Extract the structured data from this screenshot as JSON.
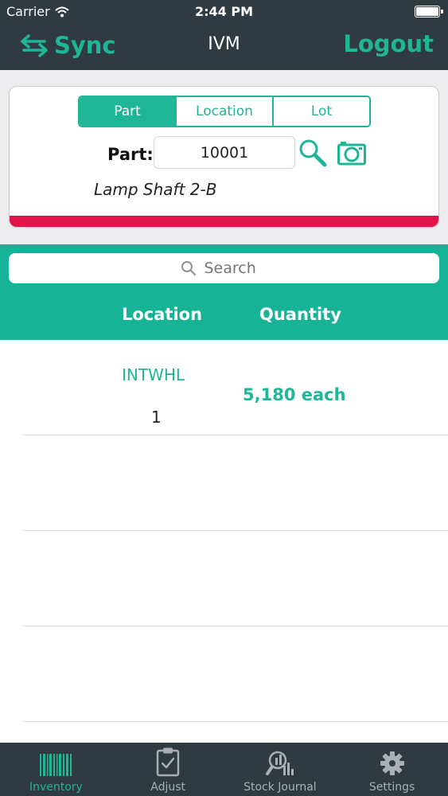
{
  "status_bar": {
    "carrier": "Carrier",
    "time": "2:44 PM"
  },
  "nav": {
    "sync_label": "Sync",
    "title": "IVM",
    "logout_label": "Logout"
  },
  "segments": [
    {
      "label": "Part",
      "selected": true
    },
    {
      "label": "Location",
      "selected": false
    },
    {
      "label": "Lot",
      "selected": false
    }
  ],
  "part_lookup": {
    "label": "Part:",
    "value": "10001",
    "description": "Lamp Shaft 2-B"
  },
  "search": {
    "placeholder": "Search"
  },
  "columns": {
    "location": "Location",
    "quantity": "Quantity"
  },
  "rows": [
    {
      "location": "INTWHL",
      "location_number": "1",
      "quantity": "5,180 each"
    }
  ],
  "tabs": [
    {
      "label": "Inventory",
      "icon": "barcode-icon",
      "active": true
    },
    {
      "label": "Adjust",
      "icon": "clipboard-check-icon",
      "active": false
    },
    {
      "label": "Stock Journal",
      "icon": "journal-chart-icon",
      "active": false
    },
    {
      "label": "Settings",
      "icon": "gear-icon",
      "active": false
    }
  ],
  "colors": {
    "accent": "#1fb597",
    "header": "#2f3b40",
    "alert_bar": "#e0144a",
    "teal_panel": "#17b396"
  }
}
